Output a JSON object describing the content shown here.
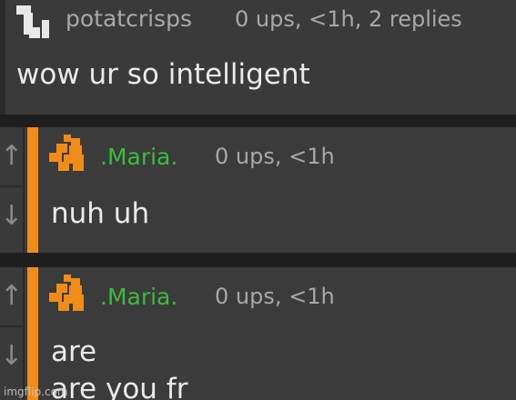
{
  "comments": [
    {
      "username": "potatcrisps",
      "meta": "0 ups, <1h, 2 replies",
      "body": "wow ur so intelligent"
    },
    {
      "username": ".Maria.",
      "meta": "0 ups, <1h",
      "body": "nuh uh",
      "accent_color": "#f08c1a",
      "name_color": "#3dbb3d"
    },
    {
      "username": ".Maria.",
      "meta": "0 ups, <1h",
      "body_line1": "are",
      "body_line2": "are you fr",
      "accent_color": "#f08c1a",
      "name_color": "#3dbb3d"
    }
  ],
  "vote": {
    "up_icon": "arrow-up-icon",
    "down_icon": "arrow-down-icon",
    "up_glyph": "↑",
    "down_glyph": "↓"
  },
  "watermark": "imgflip.com"
}
